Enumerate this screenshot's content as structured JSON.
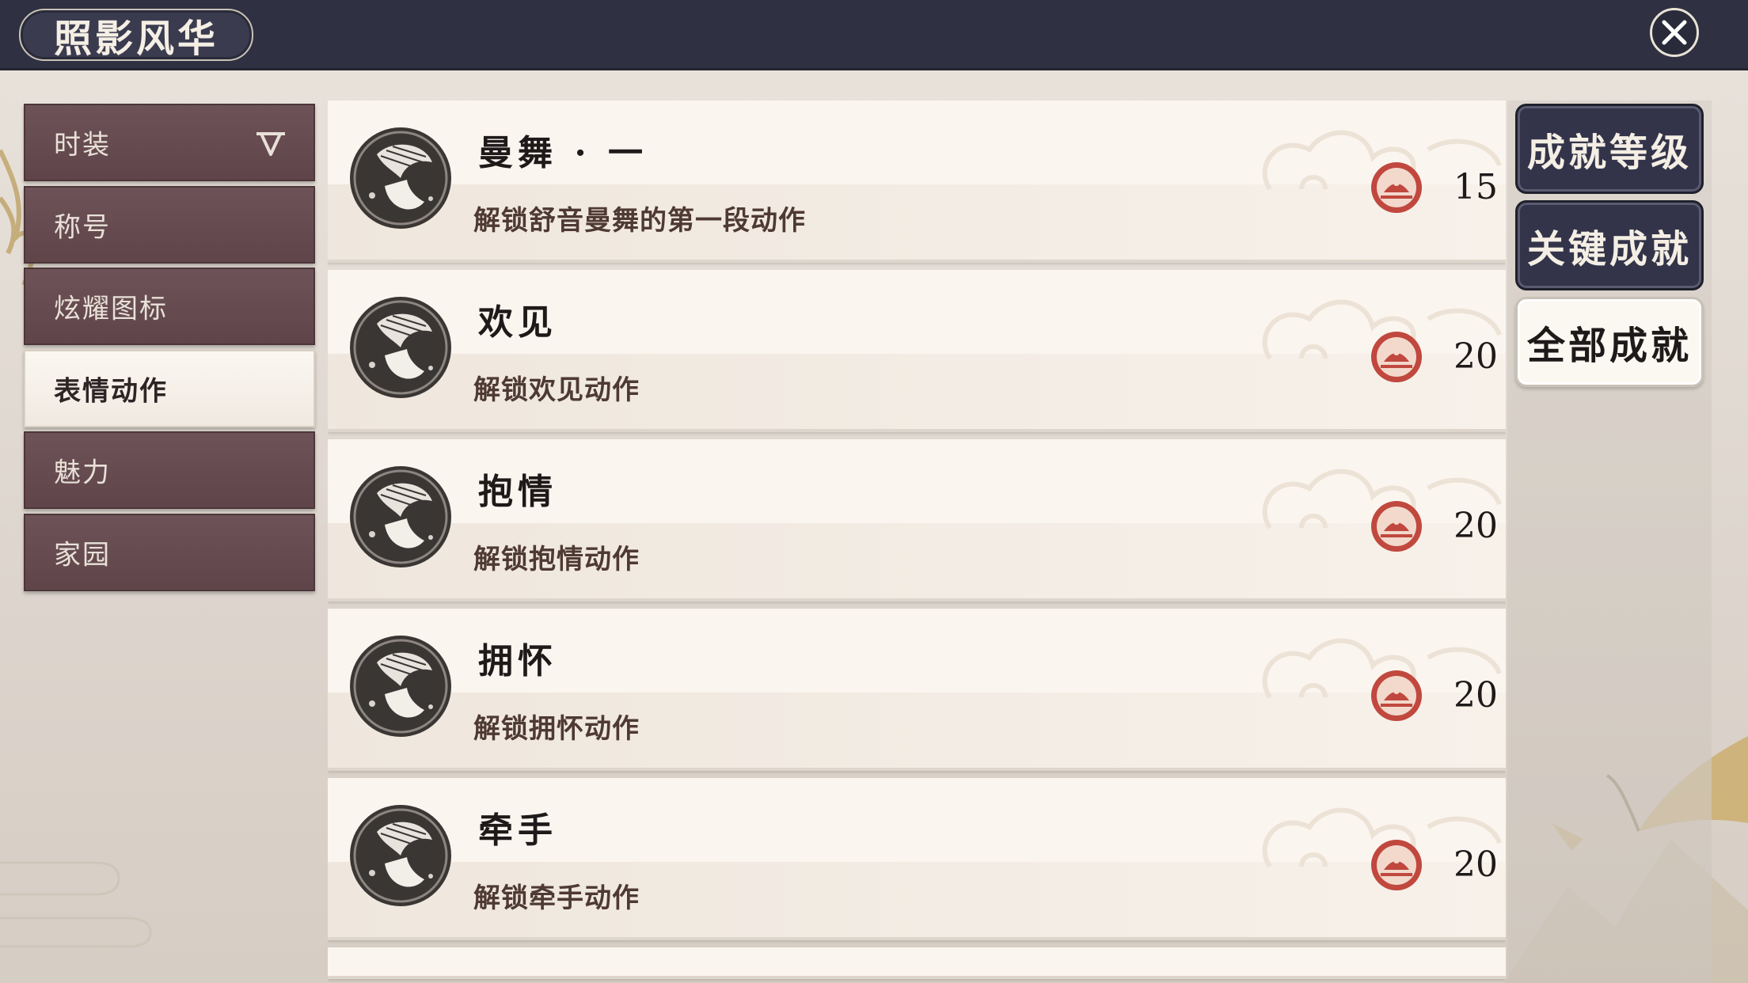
{
  "header": {
    "title": "照影风华"
  },
  "sidebar": {
    "items": [
      {
        "label": "时装",
        "has_dropdown": true,
        "active": false
      },
      {
        "label": "称号",
        "active": false
      },
      {
        "label": "炫耀图标",
        "active": false
      },
      {
        "label": "表情动作",
        "active": true
      },
      {
        "label": "魅力",
        "active": false
      },
      {
        "label": "家园",
        "active": false
      }
    ]
  },
  "achievements": [
    {
      "name": "曼舞 · 一",
      "description": "解锁舒音曼舞的第一段动作",
      "points": "15"
    },
    {
      "name": "欢见",
      "description": "解锁欢见动作",
      "points": "20"
    },
    {
      "name": "抱情",
      "description": "解锁抱情动作",
      "points": "20"
    },
    {
      "name": "拥怀",
      "description": "解锁拥怀动作",
      "points": "20"
    },
    {
      "name": "牵手",
      "description": "解锁牵手动作",
      "points": "20"
    }
  ],
  "right_tabs": [
    {
      "label": "成就等级",
      "active": false
    },
    {
      "label": "关键成就",
      "active": false
    },
    {
      "label": "全部成就",
      "active": true
    }
  ],
  "icons": {
    "close": "close-icon",
    "dropdown": "chevron-down-icon",
    "emblem": "gramophone-emblem-icon",
    "points_badge": "achievement-points-icon"
  },
  "colors": {
    "topbar": "#2f3042",
    "sidebar_item": "#5f4549",
    "card_bg": "#fbf5ef",
    "badge_red": "#c0483e",
    "tab_dark": "#33344a"
  }
}
